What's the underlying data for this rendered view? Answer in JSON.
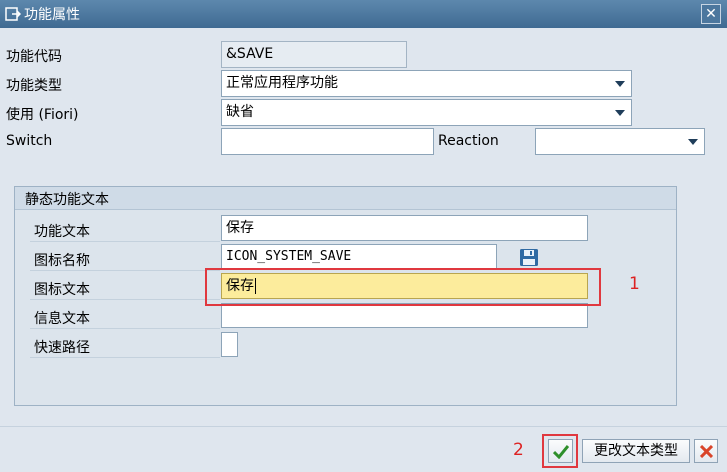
{
  "window": {
    "title": "功能属性",
    "close_label": "✕"
  },
  "form": {
    "function_code_label": "功能代码",
    "function_code_value": "&SAVE",
    "function_type_label": "功能类型",
    "function_type_value": "正常应用程序功能",
    "usage_label": "使用 (Fiori)",
    "usage_value": "缺省",
    "switch_label": "Switch",
    "switch_value": "",
    "reaction_label": "Reaction",
    "reaction_value": ""
  },
  "static_text": {
    "group_title": "静态功能文本",
    "function_text_label": "功能文本",
    "function_text_value": "保存",
    "icon_name_label": "图标名称",
    "icon_name_value": "ICON_SYSTEM_SAVE",
    "icon_text_label": "图标文本",
    "icon_text_value": "保存",
    "info_text_label": "信息文本",
    "info_text_value": "",
    "shortcut_label": "快速路径",
    "shortcut_value": ""
  },
  "annotations": {
    "marker_1": "1",
    "marker_2": "2"
  },
  "buttons": {
    "change_text_type_label": "更改文本类型"
  },
  "colors": {
    "title_bar": "#4a769c",
    "focus_field": "#fcec9c",
    "annotation_red": "#e0383f"
  },
  "icons": [
    "window-icon",
    "close-icon",
    "save-icon",
    "confirm-icon",
    "cancel-icon"
  ]
}
